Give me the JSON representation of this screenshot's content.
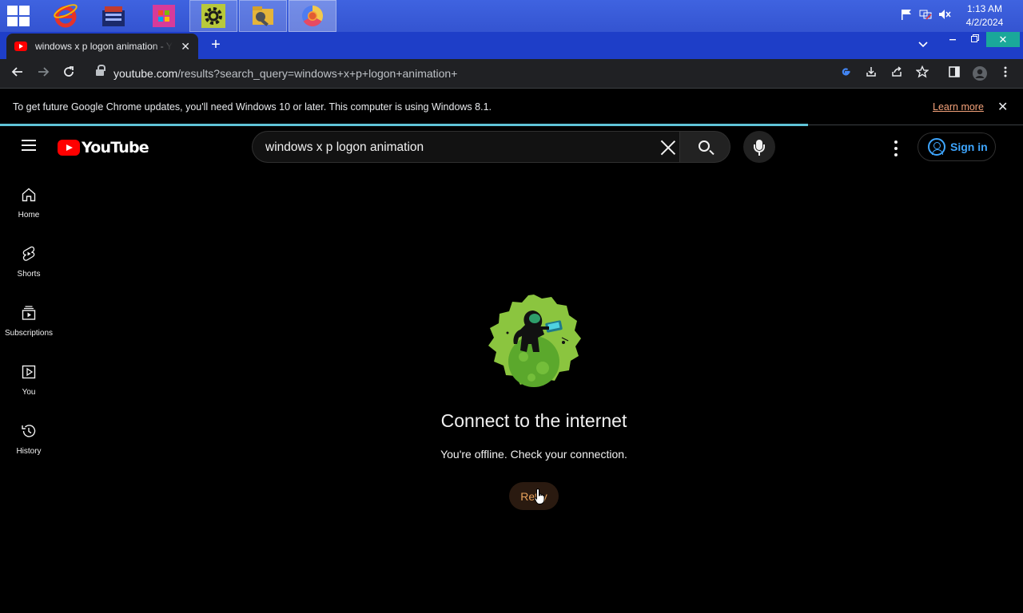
{
  "taskbar": {
    "apps": [
      "start-menu",
      "internet-explorer",
      "media-app",
      "store",
      "settings",
      "file-explorer",
      "chrome"
    ],
    "clock_time": "1:13 AM",
    "clock_date": "4/2/2024"
  },
  "browser": {
    "tab_title": "windows x p logon animation - Y",
    "new_tab": "+",
    "url_host": "youtube.com",
    "url_path": "/results?search_query=windows+x+p+logon+animation+",
    "info_message": "To get future Google Chrome updates, you'll need Windows 10 or later. This computer is using Windows 8.1.",
    "learn_more": "Learn more",
    "load_progress": 0.79
  },
  "youtube": {
    "logo_text": "YouTube",
    "search_value": "windows x p logon animation",
    "sign_in": "Sign in",
    "guide": [
      {
        "label": "Home",
        "icon": "home-icon"
      },
      {
        "label": "Shorts",
        "icon": "shorts-icon"
      },
      {
        "label": "Subscriptions",
        "icon": "subscriptions-icon"
      },
      {
        "label": "You",
        "icon": "you-icon"
      },
      {
        "label": "History",
        "icon": "history-icon"
      }
    ],
    "offline_title": "Connect to the internet",
    "offline_message": "You're offline. Check your connection.",
    "retry_label": "Retry"
  },
  "colors": {
    "taskbar": "#3454d1",
    "youtube_red": "#ff0000",
    "link_blue": "#3ea6ff",
    "progress": "#5fc4d8",
    "illustration_green": "#8bc53f"
  }
}
